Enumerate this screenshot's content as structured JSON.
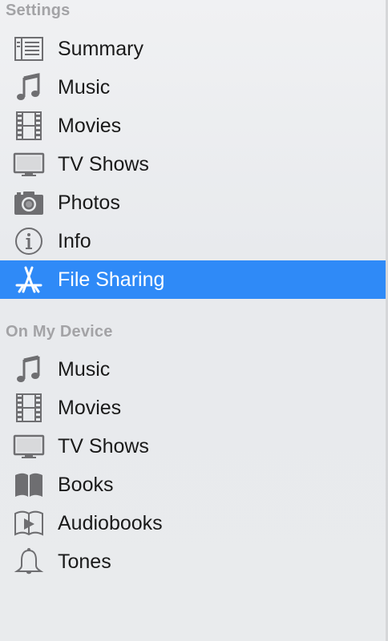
{
  "sections": [
    {
      "header": "Settings",
      "items": [
        {
          "label": "Summary",
          "icon": "summary-icon"
        },
        {
          "label": "Music",
          "icon": "music-note-icon"
        },
        {
          "label": "Movies",
          "icon": "film-strip-icon"
        },
        {
          "label": "TV Shows",
          "icon": "tv-icon"
        },
        {
          "label": "Photos",
          "icon": "camera-icon"
        },
        {
          "label": "Info",
          "icon": "info-icon"
        },
        {
          "label": "File Sharing",
          "icon": "app-store-icon",
          "selected": true
        }
      ]
    },
    {
      "header": "On My Device",
      "items": [
        {
          "label": "Music",
          "icon": "music-note-icon"
        },
        {
          "label": "Movies",
          "icon": "film-strip-icon"
        },
        {
          "label": "TV Shows",
          "icon": "tv-icon"
        },
        {
          "label": "Books",
          "icon": "book-icon"
        },
        {
          "label": "Audiobooks",
          "icon": "audiobook-icon"
        },
        {
          "label": "Tones",
          "icon": "bell-icon"
        }
      ]
    }
  ],
  "colors": {
    "selection": "#2f8af7",
    "header_text": "#a3a3a6",
    "icon_gray": "#6e6e71"
  }
}
